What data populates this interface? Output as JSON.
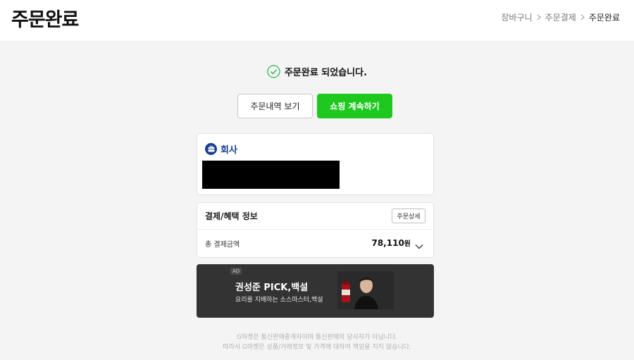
{
  "header": {
    "title": "주문완료",
    "breadcrumb": [
      "장바구니",
      "주문결제",
      "주문완료"
    ]
  },
  "status": {
    "message": "주문완료 되었습니다."
  },
  "actions": {
    "view_order_label": "주문내역 보기",
    "continue_shopping_label": "쇼핑 계속하기"
  },
  "address": {
    "label": "회사"
  },
  "payment": {
    "title": "결제/혜택 정보",
    "detail_button": "주문상세",
    "total_label": "총 결제금액",
    "total_amount": "78,110",
    "currency_unit": "원"
  },
  "ad": {
    "badge": "AD",
    "title": "권성준 PICK,백설",
    "subtitle": "요리를 지배하는 소스마스터,백설"
  },
  "footer": {
    "line1": "G마켓은 통신판매중개자이며 통신판매의 당사자가 아닙니다.",
    "line2": "따라서 G마켓은 상품/거래정보 및 가격에 대하여 책임을 지지 않습니다."
  },
  "colors": {
    "brand_green": "#1fc81f",
    "address_blue": "#1b3f8f",
    "ad_background": "#333333"
  }
}
